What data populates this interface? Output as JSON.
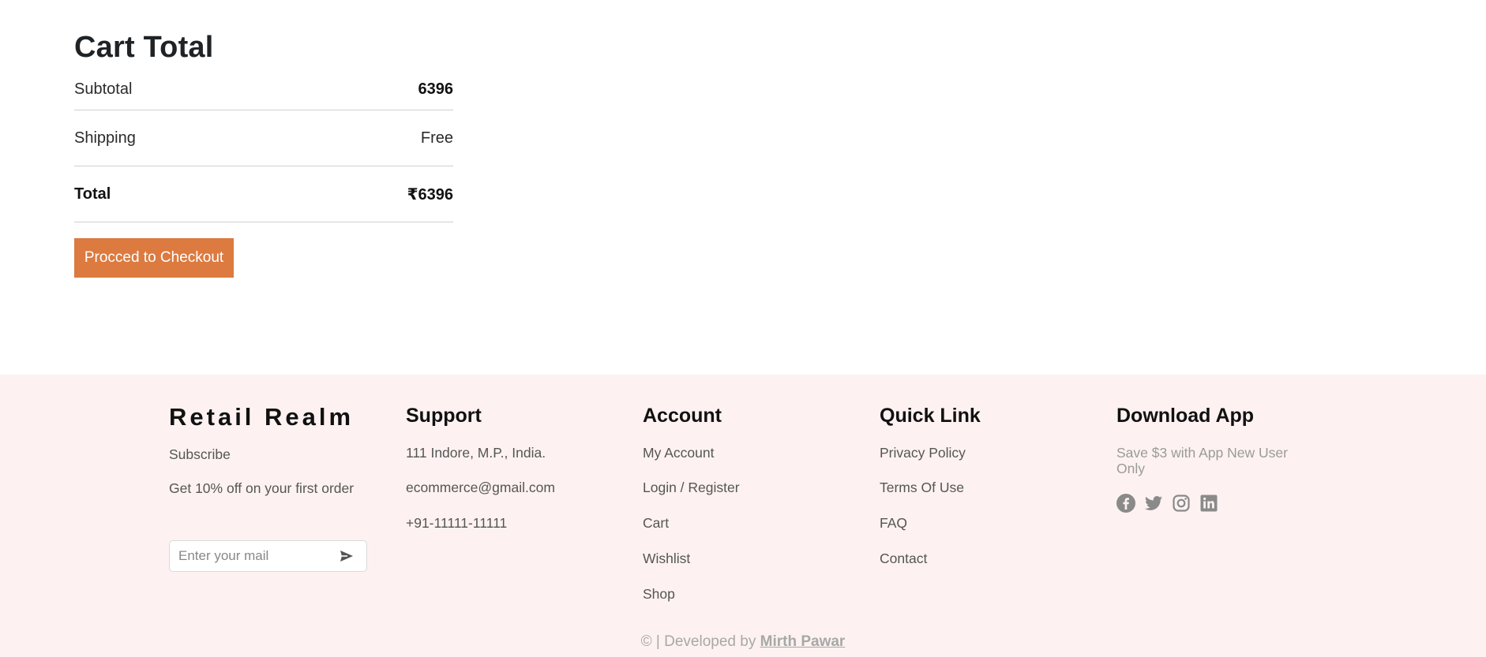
{
  "cart": {
    "title": "Cart Total",
    "rows": [
      {
        "label": "Subtotal",
        "value": "6396"
      },
      {
        "label": "Shipping",
        "value": "Free"
      },
      {
        "label": "Total",
        "value": "₹6396"
      }
    ],
    "checkout_label": "Procced to Checkout",
    "accent_color": "#dc7a40"
  },
  "footer": {
    "background": "#fdf2f1",
    "brand": {
      "name": "Retail Realm",
      "subscribe": "Subscribe",
      "offer": "Get 10% off on your first order",
      "mail_placeholder": "Enter your mail",
      "send_icon": "send-icon"
    },
    "support": {
      "title": "Support",
      "items": [
        "111 Indore, M.P., India.",
        "ecommerce@gmail.com",
        "+91-11111-11111"
      ]
    },
    "account": {
      "title": "Account",
      "items": [
        "My Account",
        "Login / Register",
        "Cart",
        "Wishlist",
        "Shop"
      ]
    },
    "quick_link": {
      "title": "Quick Link",
      "items": [
        "Privacy Policy",
        "Terms Of Use",
        "FAQ",
        "Contact"
      ]
    },
    "download": {
      "title": "Download App",
      "note": "Save $3 with App New User Only",
      "socials": [
        "facebook-icon",
        "twitter-icon",
        "instagram-icon",
        "linkedin-icon"
      ]
    },
    "copyright": {
      "prefix": "© | Developed by ",
      "author": "Mirth Pawar"
    }
  }
}
